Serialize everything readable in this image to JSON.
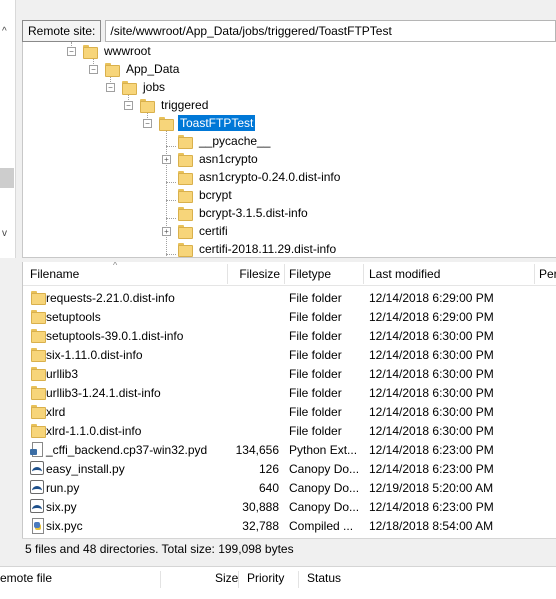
{
  "site_bar": {
    "label": "Remote site:",
    "path": "/site/wwwroot/App_Data/jobs/triggered/ToastFTPTest"
  },
  "tree": {
    "items": [
      {
        "label": "wwwroot",
        "expander": "−"
      },
      {
        "label": "App_Data",
        "expander": "−"
      },
      {
        "label": "jobs",
        "expander": "−"
      },
      {
        "label": "triggered",
        "expander": "−"
      },
      {
        "label": "ToastFTPTest",
        "expander": "−",
        "selected": true
      },
      {
        "label": "__pycache__",
        "expander": ""
      },
      {
        "label": "asn1crypto",
        "expander": "+"
      },
      {
        "label": "asn1crypto-0.24.0.dist-info",
        "expander": ""
      },
      {
        "label": "bcrypt",
        "expander": ""
      },
      {
        "label": "bcrypt-3.1.5.dist-info",
        "expander": ""
      },
      {
        "label": "certifi",
        "expander": "+"
      },
      {
        "label": "certifi-2018.11.29.dist-info",
        "expander": ""
      }
    ]
  },
  "file_list": {
    "columns": {
      "name": "Filename",
      "size": "Filesize",
      "type": "Filetype",
      "modified": "Last modified",
      "perms": "Per"
    },
    "rows": [
      {
        "name": "requests-2.21.0.dist-info",
        "size": "",
        "type": "File folder",
        "modified": "12/14/2018 6:29:00 PM",
        "icon": "folder-icon"
      },
      {
        "name": "setuptools",
        "size": "",
        "type": "File folder",
        "modified": "12/14/2018 6:29:00 PM",
        "icon": "folder-icon"
      },
      {
        "name": "setuptools-39.0.1.dist-info",
        "size": "",
        "type": "File folder",
        "modified": "12/14/2018 6:30:00 PM",
        "icon": "folder-icon"
      },
      {
        "name": "six-1.11.0.dist-info",
        "size": "",
        "type": "File folder",
        "modified": "12/14/2018 6:30:00 PM",
        "icon": "folder-icon"
      },
      {
        "name": "urllib3",
        "size": "",
        "type": "File folder",
        "modified": "12/14/2018 6:30:00 PM",
        "icon": "folder-icon"
      },
      {
        "name": "urllib3-1.24.1.dist-info",
        "size": "",
        "type": "File folder",
        "modified": "12/14/2018 6:30:00 PM",
        "icon": "folder-icon"
      },
      {
        "name": "xlrd",
        "size": "",
        "type": "File folder",
        "modified": "12/14/2018 6:30:00 PM",
        "icon": "folder-icon"
      },
      {
        "name": "xlrd-1.1.0.dist-info",
        "size": "",
        "type": "File folder",
        "modified": "12/14/2018 6:30:00 PM",
        "icon": "folder-icon"
      },
      {
        "name": "_cffi_backend.cp37-win32.pyd",
        "size": "134,656",
        "type": "Python Ext...",
        "modified": "12/14/2018 6:23:00 PM",
        "icon": "pyd-file-icon"
      },
      {
        "name": "easy_install.py",
        "size": "126",
        "type": "Canopy Do...",
        "modified": "12/14/2018 6:23:00 PM",
        "icon": "py-file-icon"
      },
      {
        "name": "run.py",
        "size": "640",
        "type": "Canopy Do...",
        "modified": "12/19/2018 5:20:00 AM",
        "icon": "py-file-icon"
      },
      {
        "name": "six.py",
        "size": "30,888",
        "type": "Canopy Do...",
        "modified": "12/14/2018 6:23:00 PM",
        "icon": "py-file-icon"
      },
      {
        "name": "six.pyc",
        "size": "32,788",
        "type": "Compiled ...",
        "modified": "12/18/2018 8:54:00 AM",
        "icon": "pyc-file-icon"
      }
    ]
  },
  "status": {
    "summary": "5 files and 48 directories. Total size: 199,098 bytes"
  },
  "queue": {
    "columns": {
      "remote_file": "emote file",
      "size": "Size",
      "priority": "Priority",
      "status": "Status"
    }
  },
  "left_pane": {
    "up_arrow": "^",
    "down_arrow": "v"
  }
}
